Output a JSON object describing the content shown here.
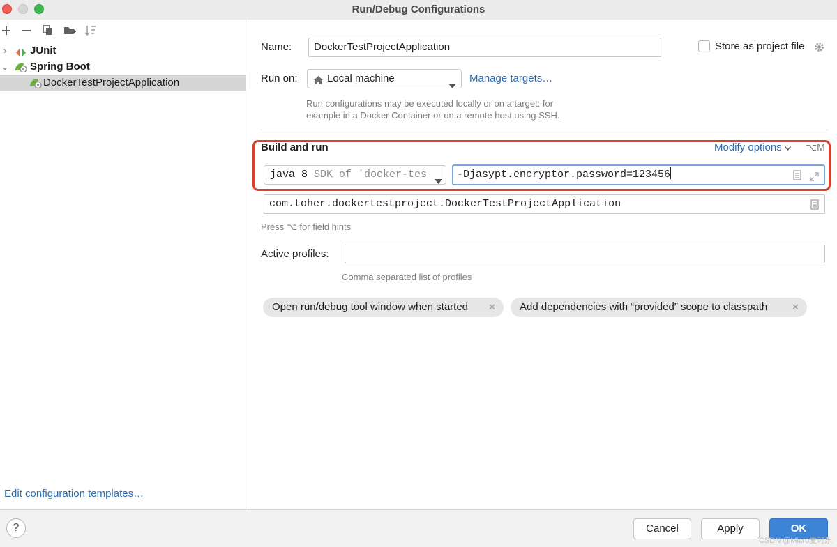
{
  "window": {
    "title": "Run/Debug Configurations"
  },
  "toolbar": {
    "add_icon": "plus-icon",
    "remove_icon": "minus-icon",
    "copy_icon": "copy-icon",
    "folder_icon": "new-folder-icon",
    "sort_icon": "sort-icon"
  },
  "tree": {
    "items": [
      {
        "label": "JUnit",
        "icon": "junit-icon",
        "expanded": false
      },
      {
        "label": "Spring Boot",
        "icon": "spring-boot-icon",
        "expanded": true
      },
      {
        "label": "DockerTestProjectApplication",
        "icon": "spring-boot-icon",
        "selected": true
      }
    ]
  },
  "left_footer": {
    "edit_templates": "Edit configuration templates…"
  },
  "form": {
    "name_label": "Name:",
    "name_value": "DockerTestProjectApplication",
    "store_label": "Store as project file",
    "store_checked": false,
    "run_on_label": "Run on:",
    "run_on_value": "Local machine",
    "manage_targets": "Manage targets…",
    "run_on_hint_1": "Run configurations may be executed locally or on a target: for",
    "run_on_hint_2": "example in a Docker Container or on a remote host using SSH.",
    "section_title": "Build and run",
    "modify_options": "Modify options",
    "modify_shortcut": "⌥M",
    "jdk_main": "java 8",
    "jdk_detail": "SDK of 'docker-tes",
    "vm_options": "-Djasypt.encryptor.password=123456",
    "main_class": "com.toher.dockertestproject.DockerTestProjectApplication",
    "field_hint": "Press ⌥ for field hints",
    "profiles_label": "Active profiles:",
    "profiles_value": "",
    "profiles_hint": "Comma separated list of profiles",
    "chips": [
      "Open run/debug tool window when started",
      "Add dependencies with “provided” scope to classpath"
    ]
  },
  "buttons": {
    "help": "?",
    "cancel": "Cancel",
    "apply": "Apply",
    "ok": "OK"
  },
  "watermark": "CSDN @Micro麦可乐",
  "colors": {
    "accent": "#3d84d6",
    "link": "#2d6db5",
    "highlight_box": "#d9402e",
    "selected_row": "#d5d5d5"
  }
}
